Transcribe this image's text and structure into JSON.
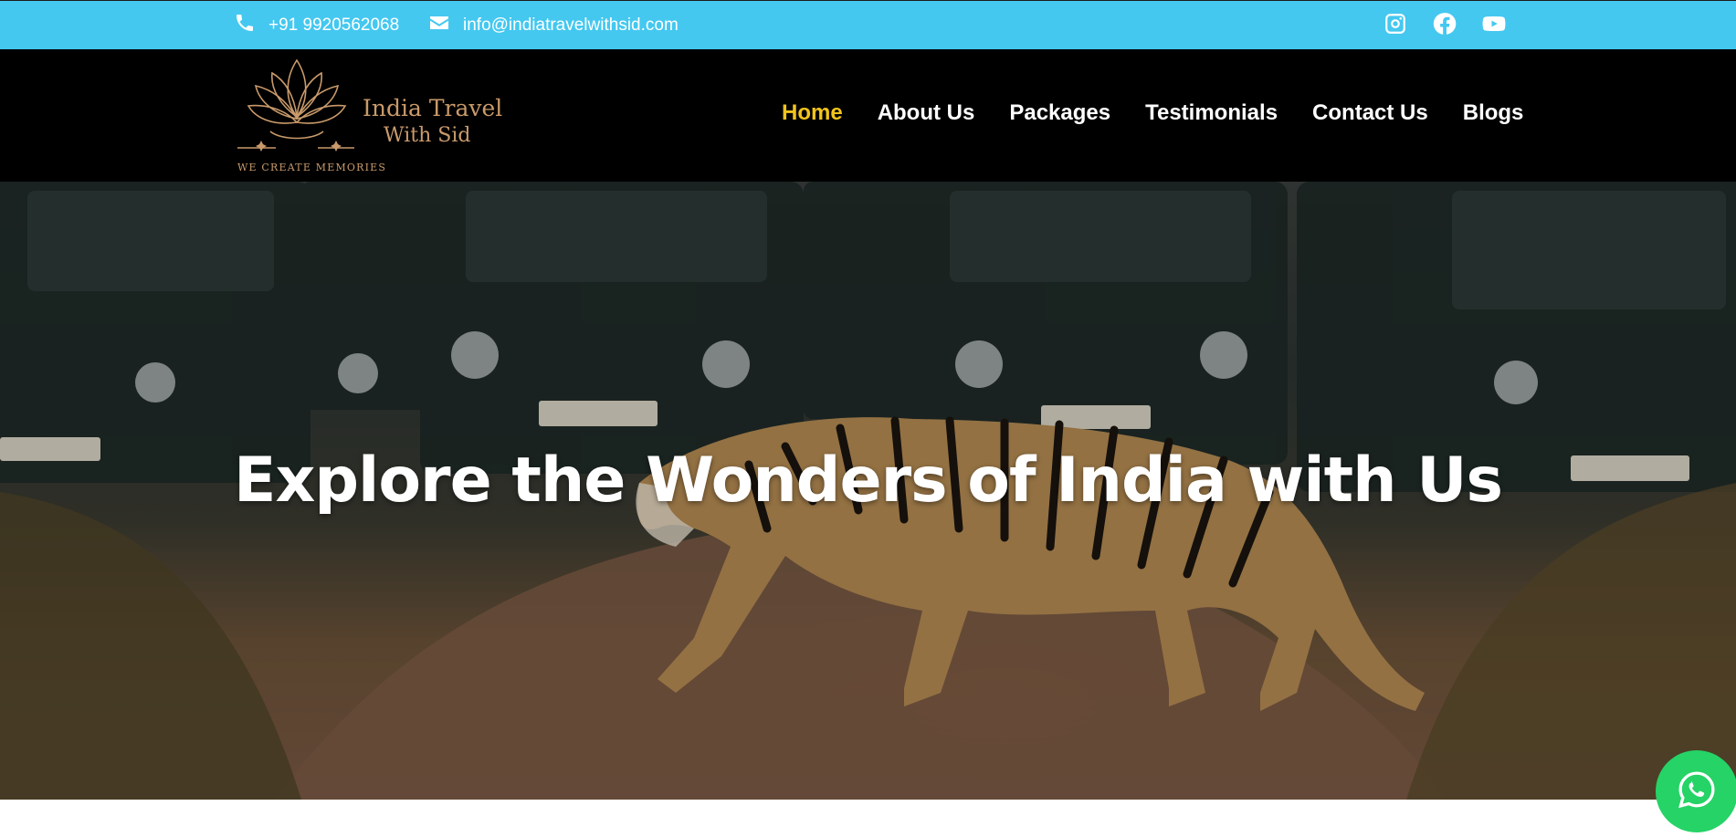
{
  "topbar": {
    "phone": "+91 9920562068",
    "email": "info@indiatravelwithsid.com",
    "socials": [
      {
        "icon": "instagram-icon"
      },
      {
        "icon": "facebook-icon"
      },
      {
        "icon": "youtube-icon"
      }
    ],
    "background_color": "#44c8f0"
  },
  "logo": {
    "line1": "India Travel",
    "line2": "With Sid",
    "tagline": "WE CREATE MEMORIES",
    "color": "#c99a6b"
  },
  "nav": {
    "items": [
      {
        "label": "Home",
        "active": true
      },
      {
        "label": "About Us",
        "active": false
      },
      {
        "label": "Packages",
        "active": false
      },
      {
        "label": "Testimonials",
        "active": false
      },
      {
        "label": "Contact Us",
        "active": false
      },
      {
        "label": "Blogs",
        "active": false
      }
    ],
    "active_color": "#f2c41b"
  },
  "hero": {
    "headline": "Explore the Wonders of India with Us"
  },
  "whatsapp": {
    "icon": "whatsapp-icon",
    "color": "#25d366"
  }
}
